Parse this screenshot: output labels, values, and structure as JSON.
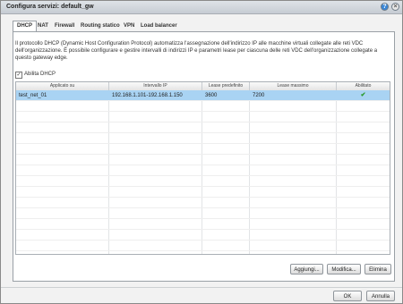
{
  "window": {
    "title": "Configura servizi: default_gw"
  },
  "tabs": [
    {
      "label": "DHCP"
    },
    {
      "label": "NAT"
    },
    {
      "label": "Firewall"
    },
    {
      "label": "Routing statico"
    },
    {
      "label": "VPN"
    },
    {
      "label": "Load balancer"
    }
  ],
  "description": "Il protocollo DHCP (Dynamic Host Configuration Protocol) automatizza l'assegnazione dell'indirizzo IP alle macchine virtuali collegate alle reti VDC dell'organizzazione. È possibile configurare e gestire intervalli di indirizzi IP e parametri lease per ciascuna delle reti VDC dell'organizzazione collegate a questo gateway edge.",
  "enable_dhcp": {
    "label": "Abilita DHCP",
    "checked": true
  },
  "table": {
    "columns": [
      "Applicato su",
      "Intervallo IP",
      "Lease predefinito",
      "Lease massimo",
      "Abilitato"
    ],
    "rows": [
      {
        "applied_to": "test_net_01",
        "ip_range": "192.168.1.101-192.168.1.150",
        "default_lease": "3600",
        "max_lease": "7200",
        "enabled": true
      }
    ]
  },
  "actions": {
    "add": "Aggiungi...",
    "modify": "Modifica...",
    "delete": "Elimina"
  },
  "footer": {
    "ok": "OK",
    "cancel": "Annulla"
  },
  "icons": {
    "help": "help-icon",
    "close": "close-icon",
    "checkmark": "checkmark-icon"
  }
}
